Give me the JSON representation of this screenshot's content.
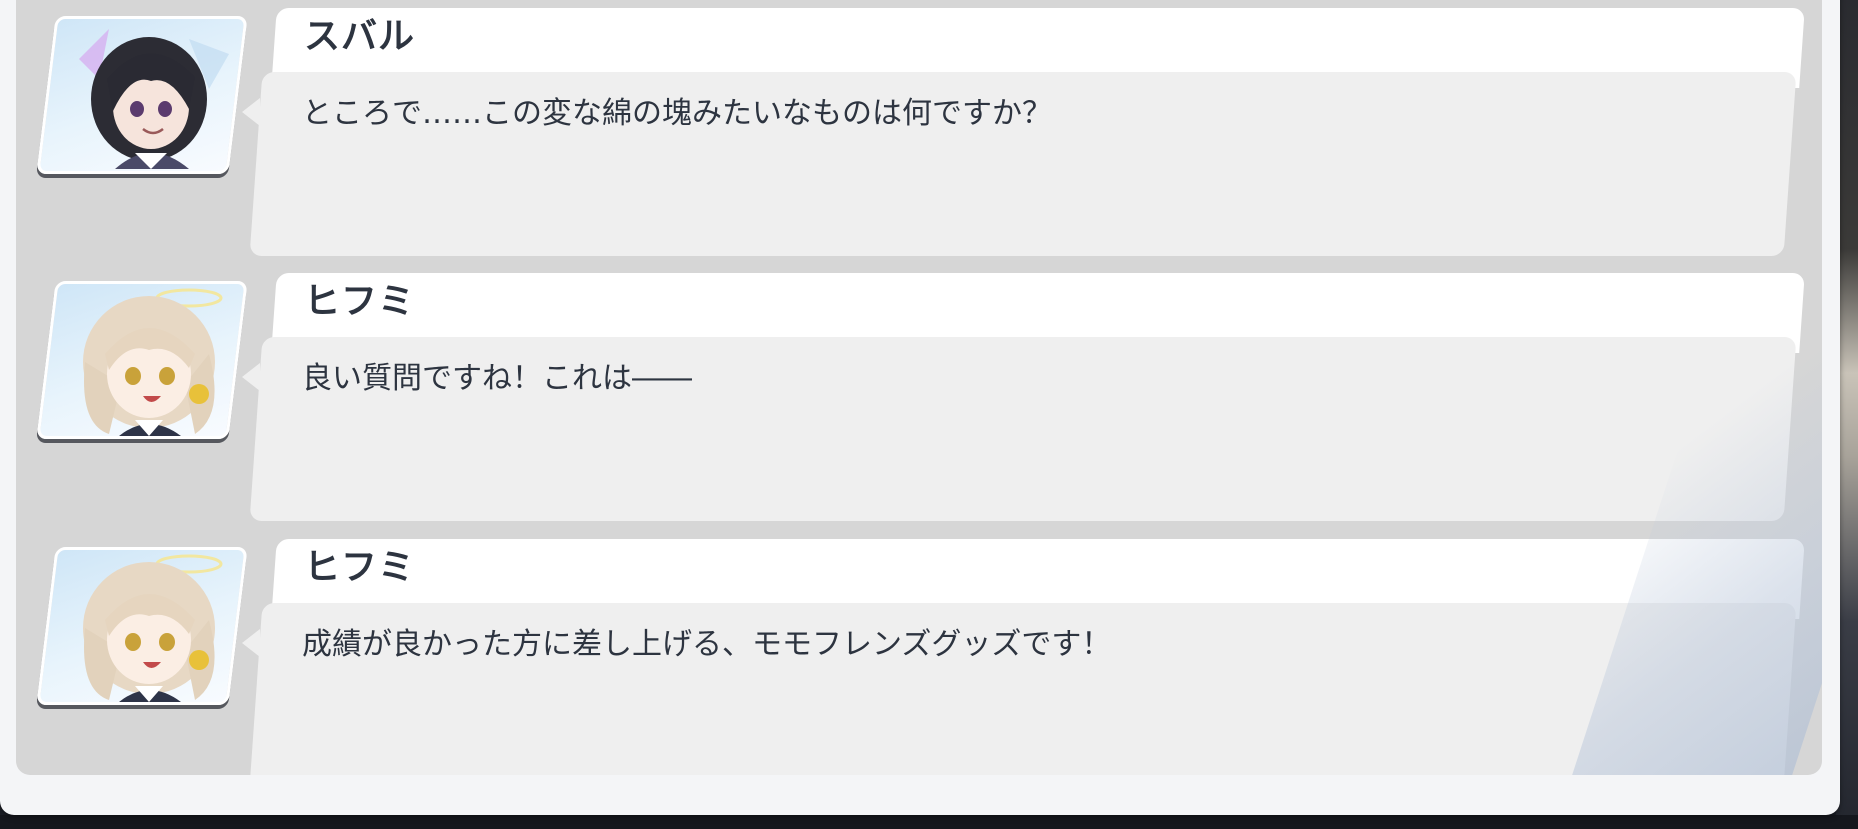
{
  "log": {
    "entries": [
      {
        "speaker": "スバル",
        "text": "ところで……この変な綿の塊みたいなものは何ですか？",
        "portrait": "subaru-portrait"
      },
      {
        "speaker": "ヒフミ",
        "text": "良い質問ですね！これは――",
        "portrait": "hifumi-portrait"
      },
      {
        "speaker": "ヒフミ",
        "text": "成績が良かった方に差し上げる、モモフレンズグッズです！",
        "portrait": "hifumi-portrait"
      }
    ]
  },
  "colors": {
    "panel": "#d6d6d6",
    "bubble": "#efefef",
    "name_tab": "#ffffff",
    "text": "#2d3440"
  }
}
